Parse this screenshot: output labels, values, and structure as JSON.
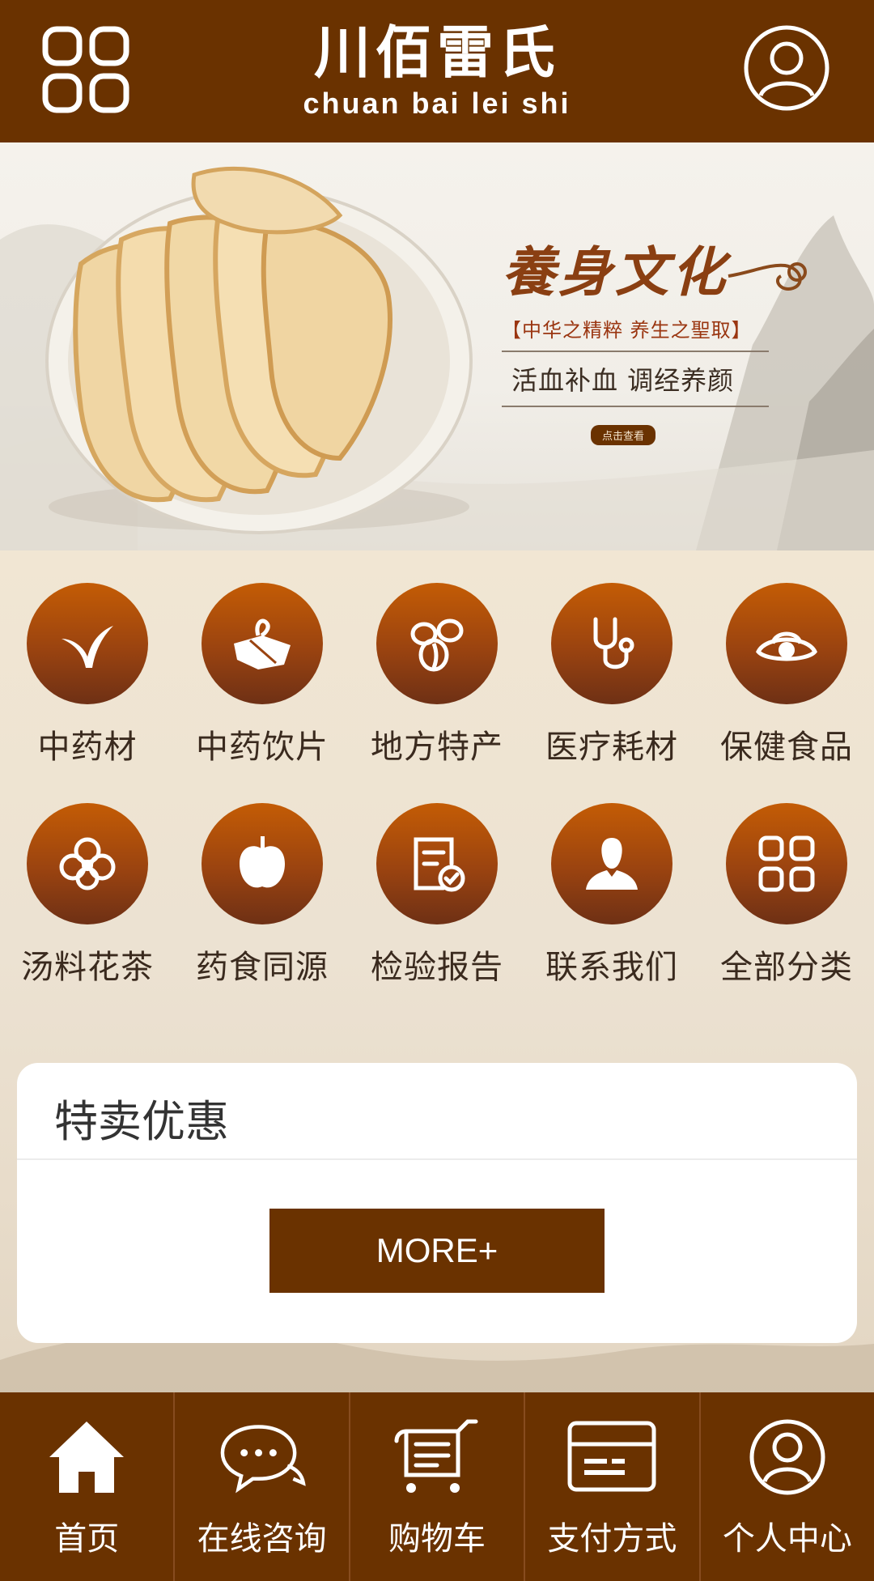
{
  "header": {
    "logo_title": "川佰雷氏",
    "logo_subtitle": "chuan bai lei shi",
    "menu_icon": "grid-icon",
    "user_icon": "user-icon"
  },
  "banner": {
    "title": "養身文化",
    "subtitle": "【中华之精粹  养生之聖取】",
    "slogan": "活血补血   调经养颜",
    "button_label": "点击查看"
  },
  "categories": [
    {
      "label": "中药材",
      "icon": "sprout-icon"
    },
    {
      "label": "中药饮片",
      "icon": "herb-pack-icon"
    },
    {
      "label": "地方特产",
      "icon": "beans-icon"
    },
    {
      "label": "医疗耗材",
      "icon": "stethoscope-icon"
    },
    {
      "label": "保健食品",
      "icon": "health-food-icon"
    },
    {
      "label": "汤料花茶",
      "icon": "flower-icon"
    },
    {
      "label": "药食同源",
      "icon": "apple-icon"
    },
    {
      "label": "检验报告",
      "icon": "report-icon"
    },
    {
      "label": "联系我们",
      "icon": "contact-icon"
    },
    {
      "label": "全部分类",
      "icon": "all-categories-icon"
    }
  ],
  "special": {
    "title": "特卖优惠",
    "more_label": "MORE+"
  },
  "bottom_nav": [
    {
      "label": "首页",
      "icon": "home-icon"
    },
    {
      "label": "在线咨询",
      "icon": "chat-icon"
    },
    {
      "label": "购物车",
      "icon": "cart-icon"
    },
    {
      "label": "支付方式",
      "icon": "payment-card-icon"
    },
    {
      "label": "个人中心",
      "icon": "profile-icon"
    }
  ],
  "colors": {
    "brand_brown": "#6a3200",
    "icon_gradient_top": "#c45c05",
    "icon_gradient_bottom": "#6e3015"
  }
}
